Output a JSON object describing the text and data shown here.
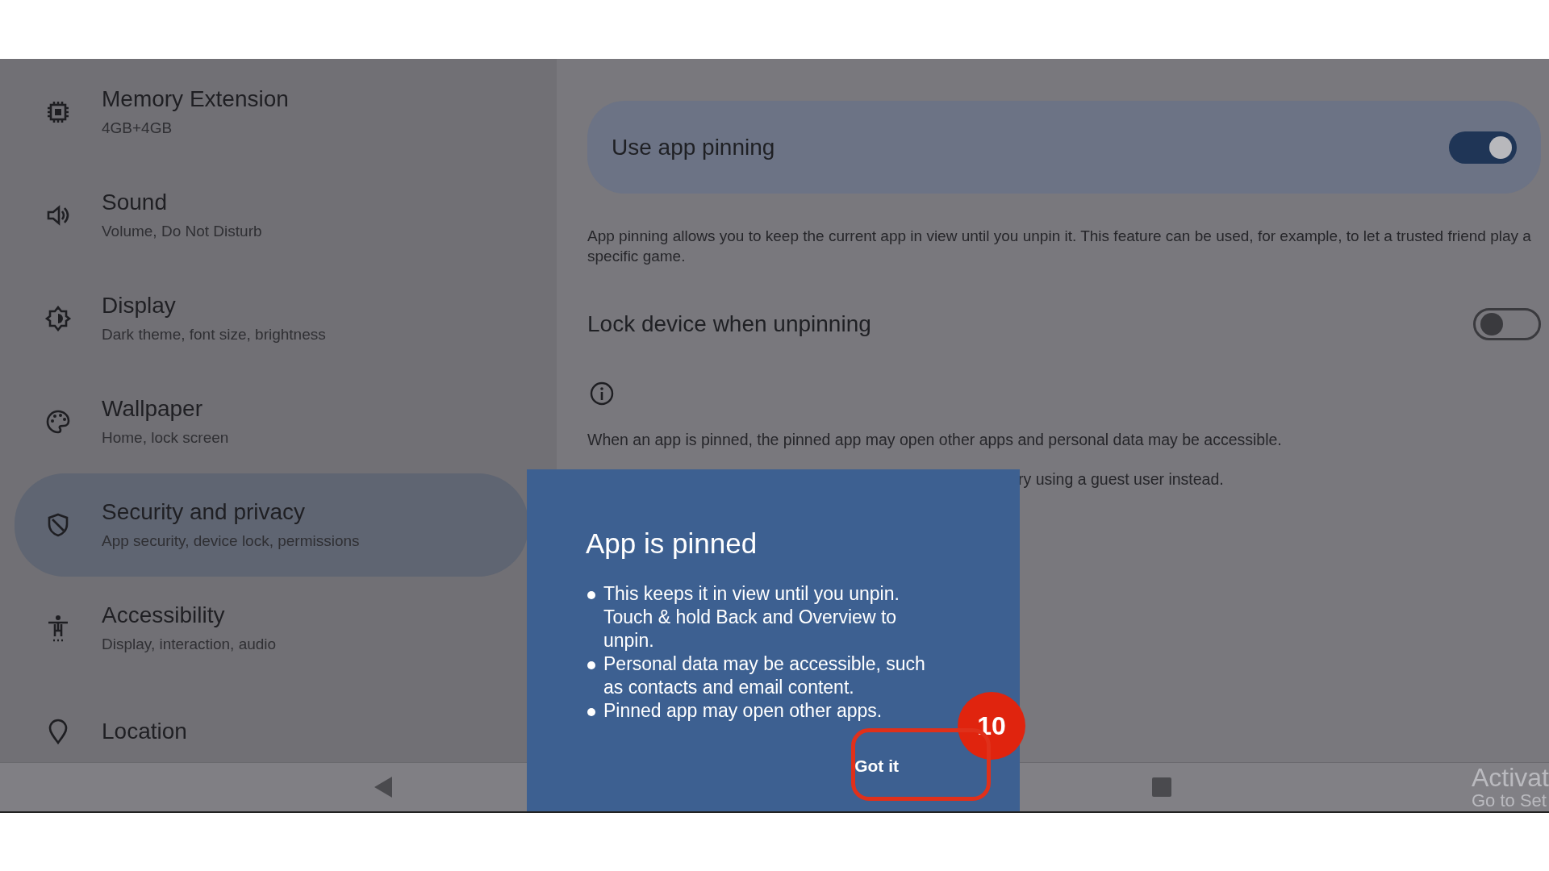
{
  "sidebar": {
    "items": [
      {
        "title": "Memory Extension",
        "subtitle": "4GB+4GB",
        "selected": false
      },
      {
        "title": "Sound",
        "subtitle": "Volume, Do Not Disturb",
        "selected": false
      },
      {
        "title": "Display",
        "subtitle": "Dark theme, font size, brightness",
        "selected": false
      },
      {
        "title": "Wallpaper",
        "subtitle": "Home, lock screen",
        "selected": false
      },
      {
        "title": "Security and privacy",
        "subtitle": "App security, device lock, permissions",
        "selected": true
      },
      {
        "title": "Accessibility",
        "subtitle": "Display, interaction, audio",
        "selected": false
      },
      {
        "title": "Location",
        "selected": false
      }
    ]
  },
  "settings": {
    "pinning": {
      "label": "Use app pinning",
      "on": true
    },
    "description": "App pinning allows you to keep the current app in view until you unpin it. This feature can be used, for example, to let a trusted friend play a specific game.",
    "lock": {
      "label": "Lock device when unpinning",
      "on": false
    },
    "info_lines": [
      "When an app is pinned, the pinned app may open other apps and personal data may be accessible.",
      "ry using a guest user instead."
    ]
  },
  "dialog": {
    "title": "App is pinned",
    "bullets": [
      "This keeps it in view until you unpin. Touch & hold Back and Overview to unpin.",
      "Personal data may be accessible, such as contacts and email content.",
      "Pinned app may open other apps."
    ],
    "button": "Got it"
  },
  "annotation": {
    "number": "10"
  },
  "os_notice": [
    "Activat",
    "Go to Set"
  ]
}
